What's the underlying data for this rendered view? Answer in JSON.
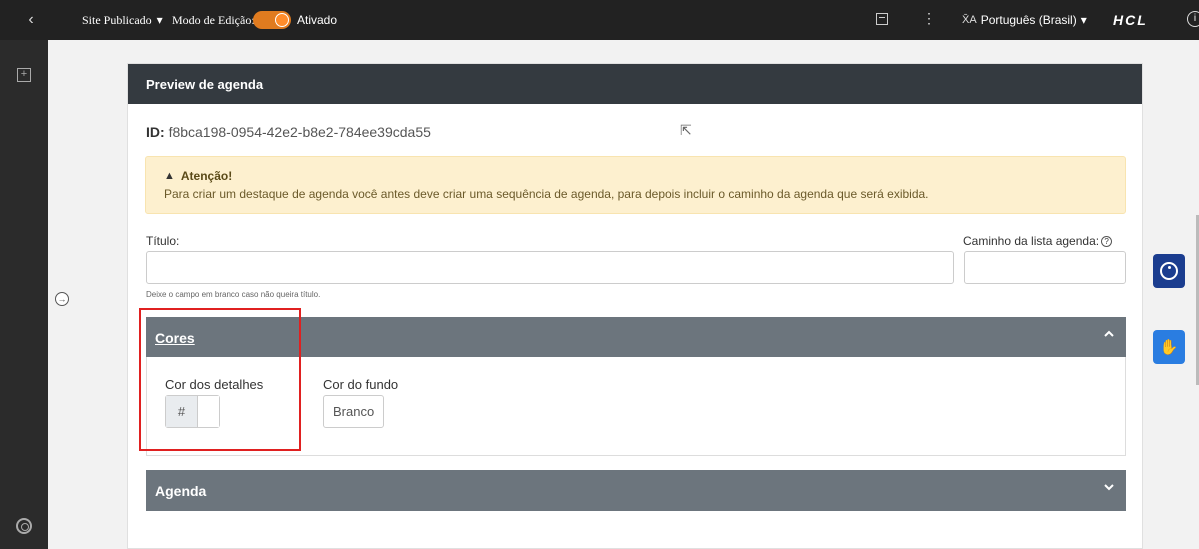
{
  "topbar": {
    "back_glyph": "‹",
    "site_label": "Site Publicado",
    "mode_label": "Modo de Edição:",
    "mode_state": "Ativado",
    "mode_on": true,
    "language": "Português (Brasil)",
    "brand": "HCL",
    "accent_color": "#e07b1f"
  },
  "card": {
    "title": "Preview de agenda",
    "id_label": "ID:",
    "id_value": "f8bca198-0954-42e2-b8e2-784ee39cda55"
  },
  "alert": {
    "title": "Atenção!",
    "message": "Para criar um destaque de agenda você antes deve criar uma sequência de agenda, para depois incluir o caminho da agenda que será exibida."
  },
  "form": {
    "title_label": "Título:",
    "title_value": "",
    "title_hint": "Deixe o campo em branco caso não queira título.",
    "path_label": "Caminho da lista agenda:",
    "path_value": ""
  },
  "cores": {
    "header": "Cores",
    "expanded": true,
    "detail_color_label": "Cor dos detalhes",
    "detail_color_prefix": "#",
    "detail_color_value": "",
    "bg_color_label": "Cor do fundo",
    "bg_color_value": "Branco"
  },
  "agenda": {
    "header": "Agenda",
    "expanded": false
  },
  "icons": {
    "back": "chevron-left-icon",
    "layout": "layout-icon",
    "kebab": "more-vertical-icon",
    "translate": "translate-icon",
    "info": "info-icon",
    "add": "add-panel-icon",
    "expand": "arrow-right-circle-icon",
    "help": "lifebuoy-icon",
    "warning": "warning-icon",
    "question": "question-circle-icon",
    "accessibility": "accessibility-icon",
    "sign_language": "sign-language-icon"
  }
}
